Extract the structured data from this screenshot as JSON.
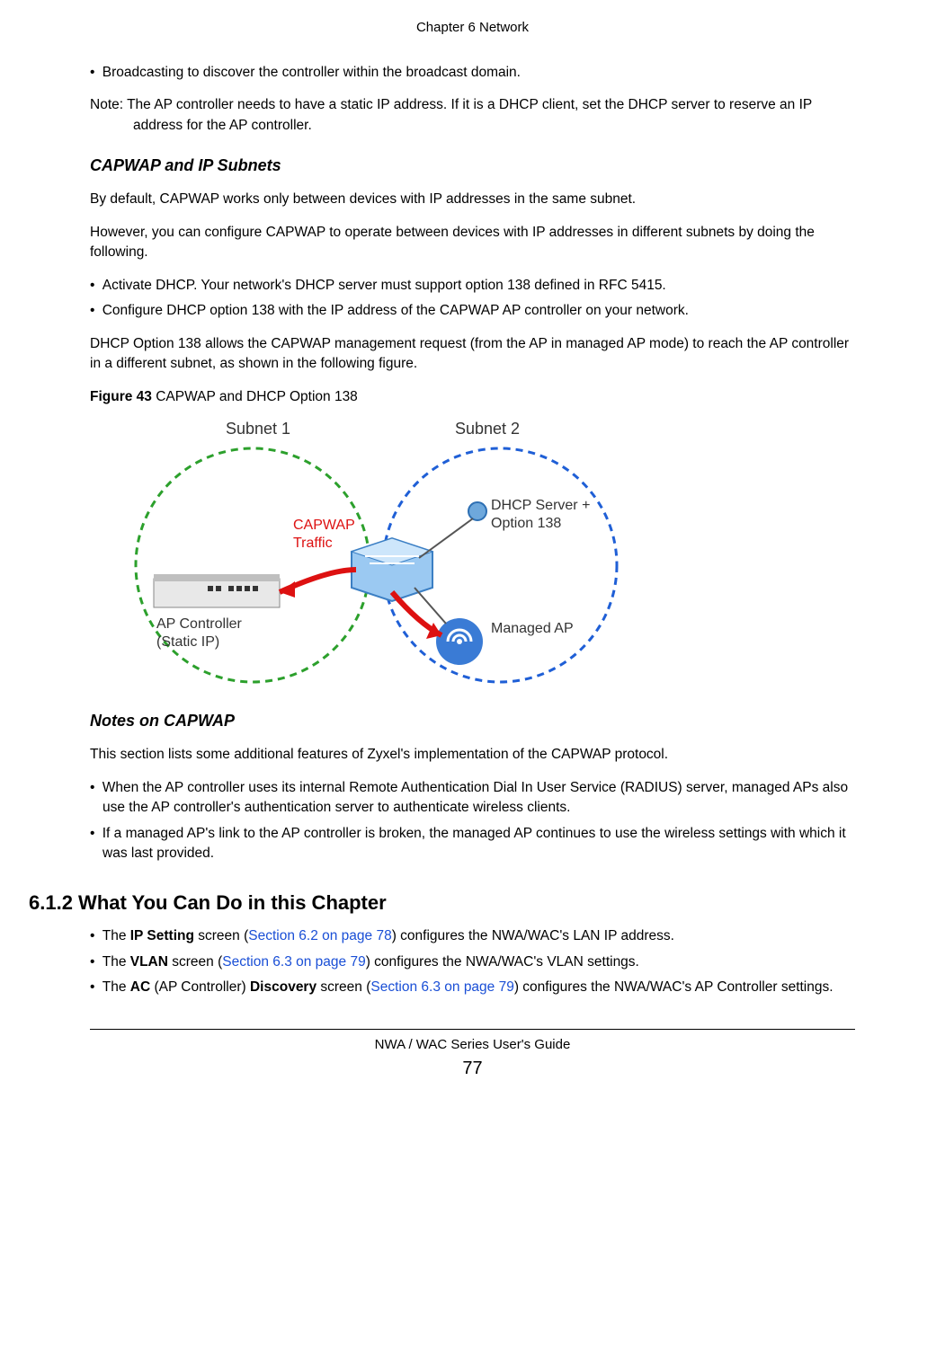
{
  "header": {
    "running": "Chapter 6 Network"
  },
  "bullets_top": [
    "Broadcasting to discover the controller within the broadcast domain."
  ],
  "note1": "Note: The AP controller needs to have a static IP address. If it is a DHCP client, set the DHCP server to reserve an IP address for the AP controller.",
  "sub1": {
    "heading": "CAPWAP and IP Subnets"
  },
  "p1": "By default, CAPWAP works only between devices with IP addresses in the same subnet.",
  "p2": "However, you can configure CAPWAP to operate between devices with IP addresses in different subnets by doing the following.",
  "bullets_mid": [
    "Activate DHCP. Your network's DHCP server must support option 138 defined in RFC 5415.",
    "Configure DHCP option 138 with the IP address of the CAPWAP AP controller on your network."
  ],
  "p3": "DHCP Option 138 allows the CAPWAP management request (from the AP in managed AP mode) to reach the AP controller in a different subnet, as shown in the following figure.",
  "figure": {
    "num": "Figure 43",
    "caption": "   CAPWAP and DHCP Option 138",
    "labels": {
      "subnet1": "Subnet 1",
      "subnet2": "Subnet 2",
      "capwap": "CAPWAP",
      "traffic": "Traffic",
      "dhcp1": "DHCP Server +",
      "dhcp2": "Option 138",
      "apctrl1": "AP Controller",
      "apctrl2": "(Static IP)",
      "managed": "Managed AP"
    }
  },
  "sub2": {
    "heading": "Notes on CAPWAP"
  },
  "p4": "This section lists some additional features of Zyxel's implementation of the CAPWAP protocol.",
  "bullets_notes": [
    "When the AP controller uses its internal Remote Authentication Dial In User Service (RADIUS) server, managed APs also use the AP controller's authentication server to authenticate wireless clients.",
    "If a managed AP's link to the AP controller is broken, the managed AP continues to use the wireless settings with which it was last provided."
  ],
  "h2": {
    "num": "6.1.2",
    "title": "  What You Can Do in this Chapter"
  },
  "cando": {
    "item1_pre": "The ",
    "item1_bold": "IP Setting",
    "item1_mid": " screen (",
    "item1_link": "Section 6.2 on page 78",
    "item1_post": ") configures the NWA/WAC's LAN IP address.",
    "item2_pre": "The ",
    "item2_bold": "VLAN",
    "item2_mid": " screen (",
    "item2_link": "Section 6.3 on page 79",
    "item2_post": ") configures the NWA/WAC's VLAN settings.",
    "item3_pre": "The ",
    "item3_bold1": "AC",
    "item3_mid1": " (AP Controller) ",
    "item3_bold2": "Discovery",
    "item3_mid2": " screen (",
    "item3_link": "Section 6.3 on page 79",
    "item3_post": ") configures the NWA/WAC's AP Controller settings."
  },
  "footer": {
    "guide": "NWA / WAC Series User's Guide",
    "page": "77"
  }
}
